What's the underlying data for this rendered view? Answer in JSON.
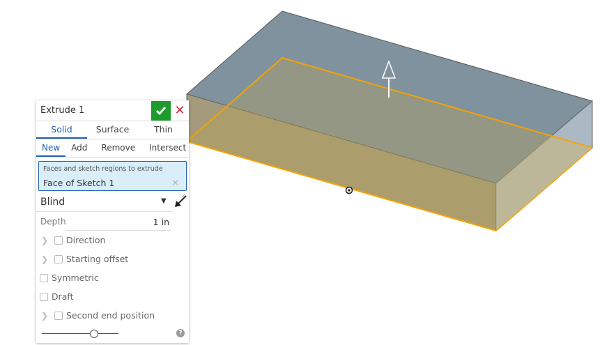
{
  "feature": {
    "title": "Extrude 1",
    "accept": "✔",
    "cancel": "✕"
  },
  "tabs": [
    "Solid",
    "Surface",
    "Thin"
  ],
  "operations": [
    "New",
    "Add",
    "Remove",
    "Intersect"
  ],
  "selection": {
    "label": "Faces and sketch regions to extrude",
    "value": "Face of Sketch 1",
    "clear": "×"
  },
  "end_type": {
    "value": "Blind"
  },
  "depth": {
    "label": "Depth",
    "value": "1 in"
  },
  "options": {
    "direction": "Direction",
    "starting_offset": "Starting offset",
    "symmetric": "Symmetric",
    "draft": "Draft",
    "second_end": "Second end position"
  },
  "help": "?",
  "slider_fraction": 0.68,
  "colors": {
    "accent": "#1f5fb4",
    "ok": "#1e9b2c",
    "sketch_edge": "#f5a300"
  }
}
